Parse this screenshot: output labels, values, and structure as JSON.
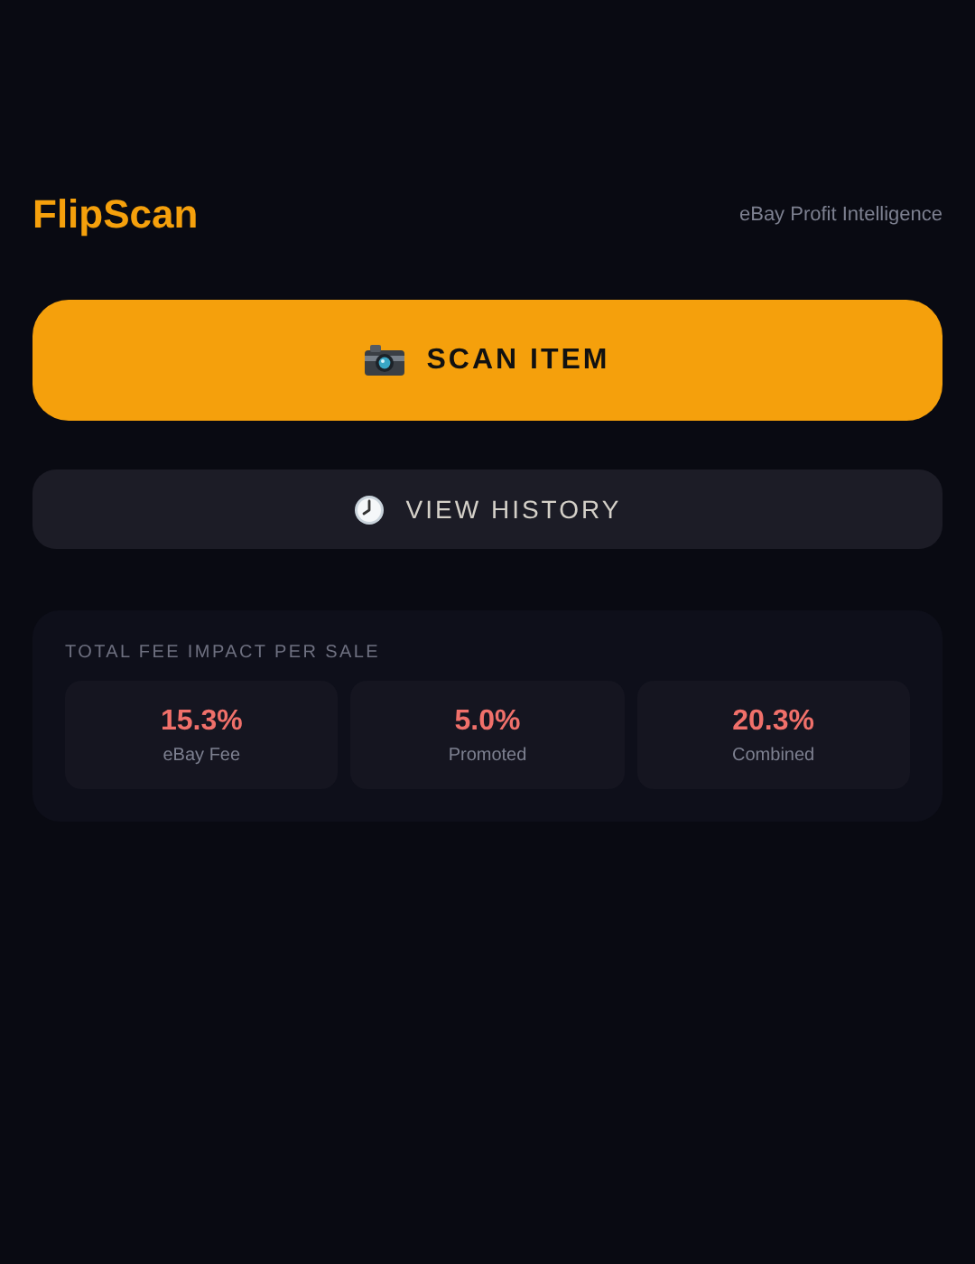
{
  "header": {
    "logo": "FlipScan",
    "tagline": "eBay Profit Intelligence"
  },
  "actions": [
    {
      "kind": "primary",
      "label": "SCAN ITEM"
    },
    {
      "kind": "secondary",
      "label": "VIEW HISTORY"
    }
  ],
  "fee_card": {
    "title": "TOTAL FEE IMPACT PER SALE",
    "stats": [
      {
        "value": "15.3%",
        "label": "eBay Fee"
      },
      {
        "value": "5.0%",
        "label": "Promoted"
      },
      {
        "value": "20.3%",
        "label": "Combined"
      }
    ]
  }
}
